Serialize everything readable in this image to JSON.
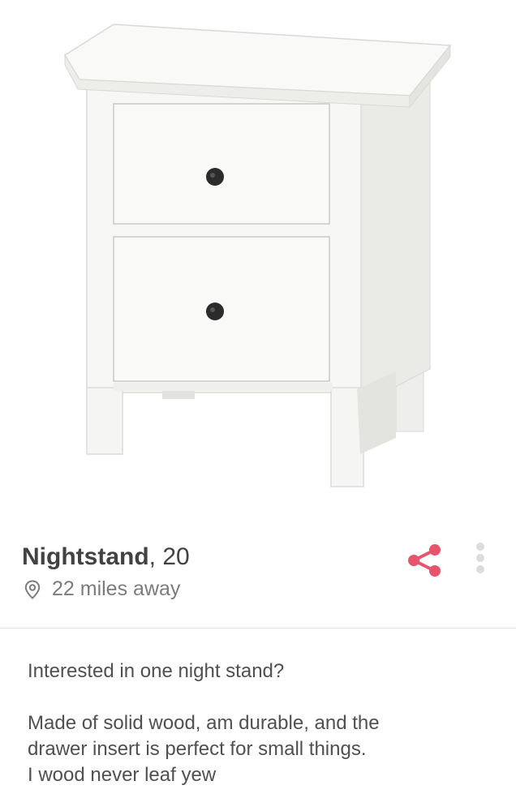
{
  "profile": {
    "name": "Nightstand",
    "age_text": ", 20",
    "distance": "22 miles away",
    "photo_subject": "nightstand-photo"
  },
  "actions": {
    "share_icon": "share-icon",
    "more_icon": "more-vertical-icon",
    "accent_color": "#e8546b"
  },
  "bio": {
    "line1": "Interested in one night stand?",
    "line2": "Made of solid wood, am durable, and the",
    "line3": "drawer insert is perfect for small things.",
    "line4": "I wood never leaf yew"
  }
}
